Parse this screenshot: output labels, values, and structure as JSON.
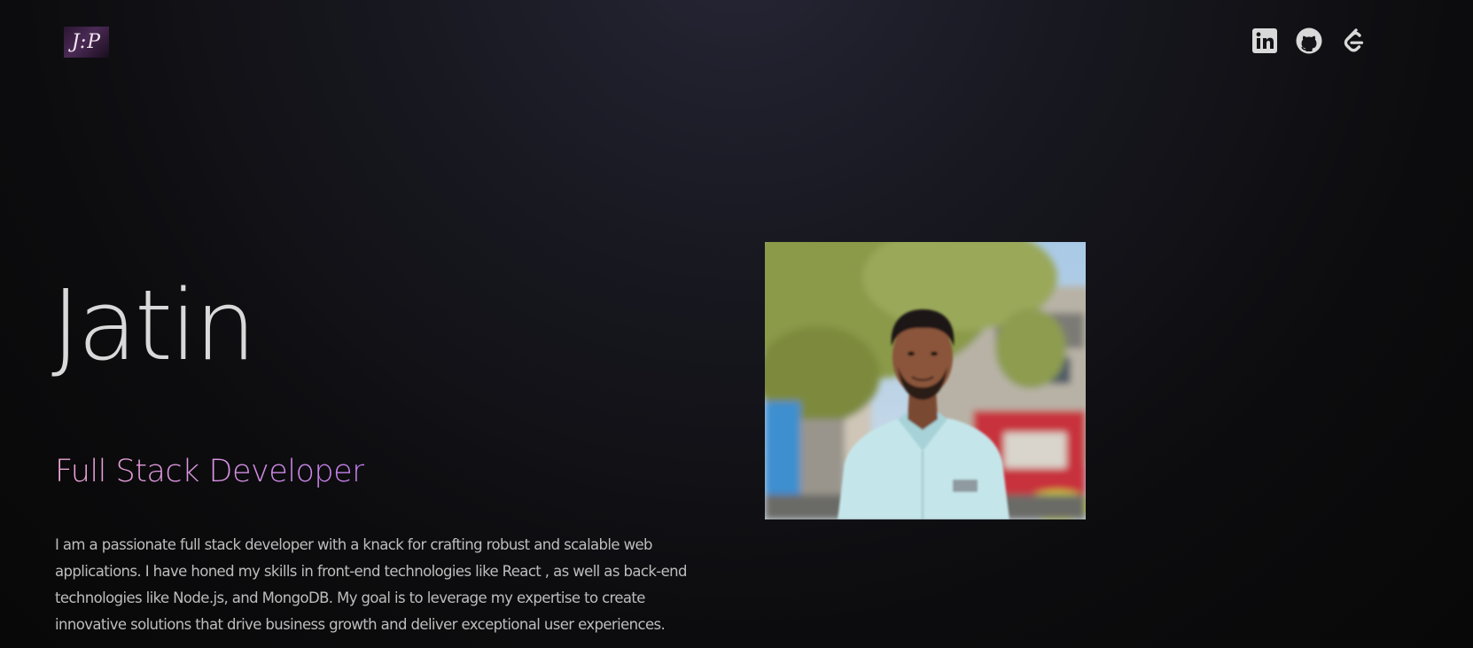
{
  "header": {
    "logo_text": "J:P",
    "social_icons": [
      "linkedin-icon",
      "github-icon",
      "leetcode-icon"
    ]
  },
  "hero": {
    "name": "Jatin",
    "role": "Full Stack Developer",
    "about": "I am a passionate full stack developer with a knack for crafting robust and scalable web applications. I have honed my skills in front-end technologies like React , as well as back-end technologies like Node.js, and MongoDB. My goal is to leverage my expertise to create innovative solutions that drive business growth and deliver exceptional user experiences."
  },
  "colors": {
    "background": "#0c0c0e",
    "role_gradient_start": "#f0a6d6",
    "role_gradient_end": "#c47fef",
    "text": "#d4d4d4",
    "icon": "#d9d9d9"
  }
}
